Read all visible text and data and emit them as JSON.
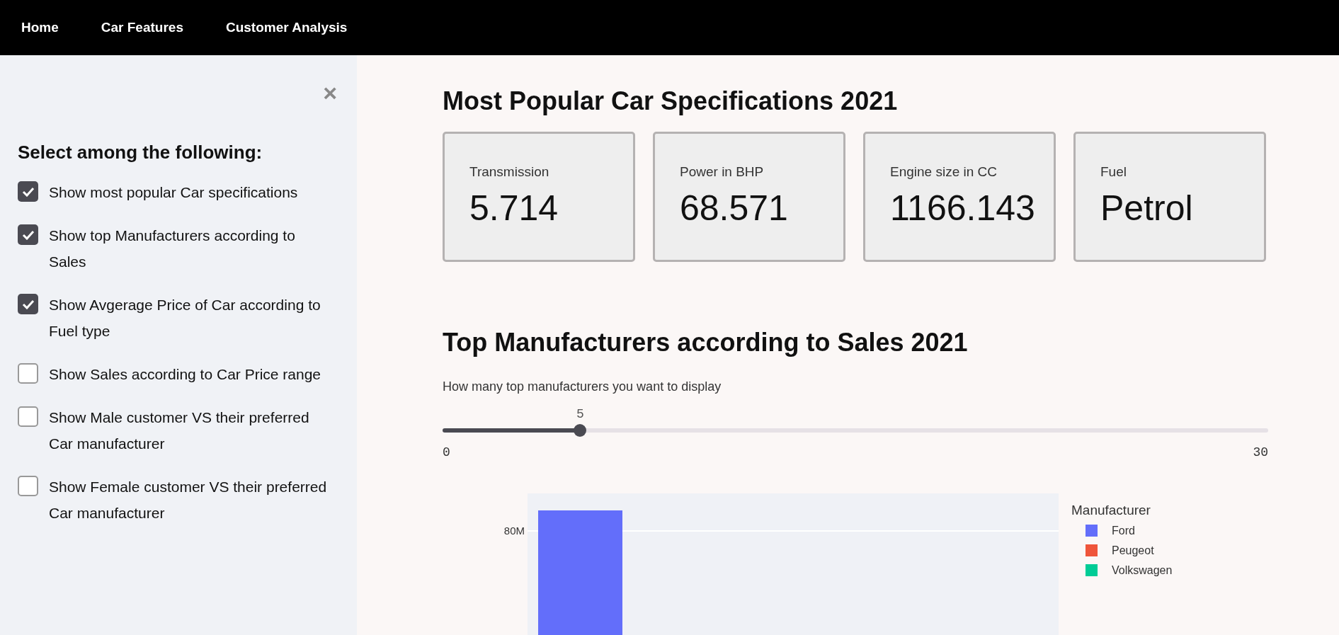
{
  "nav": {
    "items": [
      "Home",
      "Car Features",
      "Customer Analysis"
    ]
  },
  "sidebar": {
    "close": "×",
    "heading": "Select among the following:",
    "options": [
      {
        "label": "Show most popular Car specifications",
        "checked": true
      },
      {
        "label": "Show top Manufacturers according to Sales",
        "checked": true
      },
      {
        "label": "Show Avgerage Price of Car according to Fuel type",
        "checked": true
      },
      {
        "label": "Show Sales according to Car Price range",
        "checked": false
      },
      {
        "label": "Show Male customer VS their preferred Car manufacturer",
        "checked": false
      },
      {
        "label": "Show Female customer VS their preferred Car manufacturer",
        "checked": false
      }
    ]
  },
  "specs": {
    "title": "Most Popular Car Specifications 2021",
    "metrics": [
      {
        "label": "Transmission",
        "value": "5.714"
      },
      {
        "label": "Power in BHP",
        "value": "68.571"
      },
      {
        "label": "Engine size in CC",
        "value": "1166.143"
      },
      {
        "label": "Fuel",
        "value": "Petrol"
      }
    ]
  },
  "manufacturers": {
    "title": "Top Manufacturers according to Sales 2021",
    "slider": {
      "label": "How many top manufacturers you want to display",
      "value": "5",
      "min": "0",
      "max": "30",
      "level": 0.1667
    },
    "chart": {
      "ytick": "80M",
      "legend_title": "Manufacturer",
      "legend": [
        {
          "name": "Ford",
          "color": "#636efa"
        },
        {
          "name": "Peugeot",
          "color": "#ef553b"
        },
        {
          "name": "Volkswagen",
          "color": "#00cc96"
        }
      ]
    }
  }
}
